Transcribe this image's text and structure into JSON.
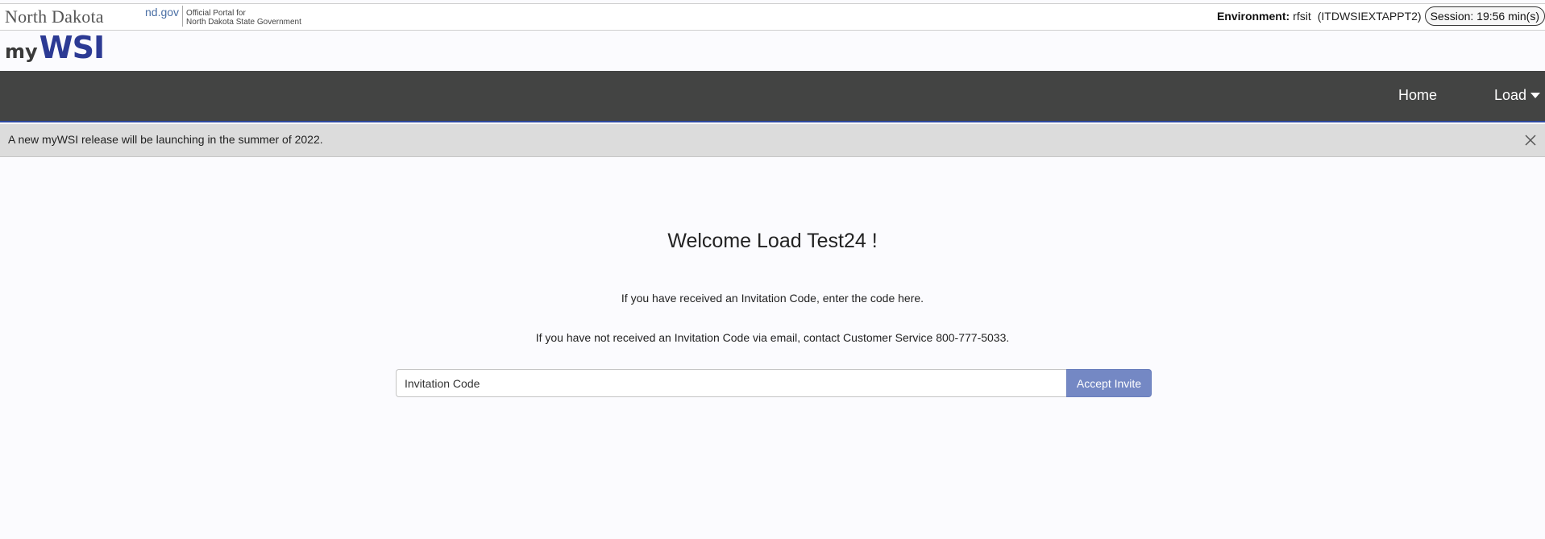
{
  "header": {
    "state_name": "North Dakota",
    "portal_domain": "nd.gov",
    "portal_tagline_line1": "Official Portal for",
    "portal_tagline_line2": "North Dakota State Government",
    "environment_label": "Environment:",
    "environment_value": "rfsit",
    "environment_host": "(ITDWSIEXTAPPT2)",
    "session_text": "Session: 19:56 min(s)"
  },
  "logo": {
    "prefix": "my",
    "name": "WSI"
  },
  "nav": {
    "items": [
      {
        "label": "Home"
      },
      {
        "label": "Load",
        "has_dropdown": true,
        "icon": "caret-down-icon"
      }
    ],
    "background_color": "#434443",
    "accent_color": "#2f4aa0"
  },
  "alert": {
    "message": "A new myWSI release will be launching in the summer of 2022.",
    "close_icon": "close-icon"
  },
  "main": {
    "welcome": "Welcome Load Test24 !",
    "instruction_1": "If you have received an Invitation Code, enter the code here.",
    "instruction_2": "If you have not received an Invitation Code via email, contact Customer Service 800-777-5033.",
    "invite_input": {
      "placeholder": "Invitation Code",
      "value": ""
    },
    "accept_button_label": "Accept Invite",
    "accept_button_color": "#7488c4"
  }
}
